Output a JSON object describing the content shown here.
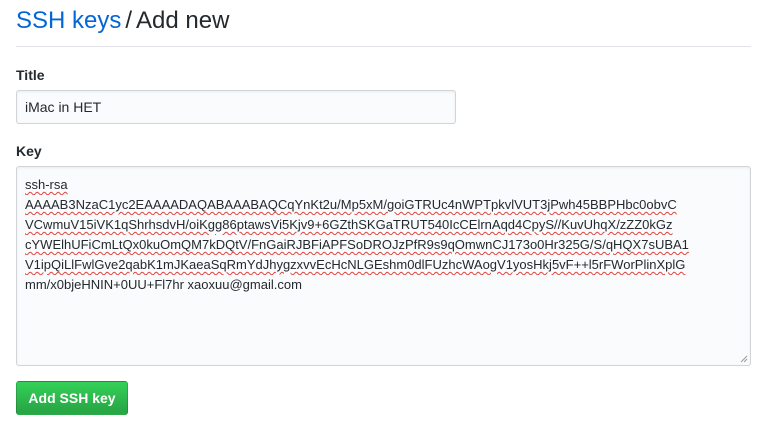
{
  "breadcrumb": {
    "link_label": "SSH keys",
    "separator": "/",
    "current_label": "Add new"
  },
  "title_field": {
    "label": "Title",
    "value": "iMac in HET"
  },
  "key_field": {
    "label": "Key",
    "lines": [
      "ssh-rsa",
      "AAAAB3NzaC1yc2EAAAADAQABAAABAQCqYnKt2u/Mp5xM/goiGTRUc4nWPTpkvlVUT3jPwh45BBPHbc0obvC",
      "VCwmuV15iVK1qShrhsdvH/oiKgg86ptawsVi5Kjv9+6GZthSKGaTRUT540IcCElrnAqd4CpyS//KuvUhqX/zZZ0kGz",
      "cYWElhUFiCmLtQx0kuOmQM7kDQtV/FnGaiRJBFiAPFSoDROJzPfR9s9qOmwnCJ173o0Hr325G/S/qHQX7sUBA1",
      "V1ipQiLlFwlGve2qabK1mJKaeaSqRmYdJhygzxvvEcHcNLGEshm0dlFUzhcWAogV1yosHkj5vF++l5rFWorPlinXplG",
      "mm/x0bjeHNIN+0UU+Fl7hr xaoxuu@gmail.com"
    ]
  },
  "submit_button": {
    "label": "Add SSH key"
  },
  "colors": {
    "link": "#0366d6",
    "button_green": "#28a745",
    "spell_error": "#e0423b"
  }
}
